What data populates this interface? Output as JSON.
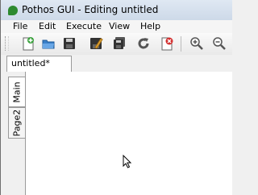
{
  "window": {
    "title": "Pothos GUI - Editing untitled",
    "app_icon": "pothos-leaf-icon"
  },
  "menu": {
    "items": [
      "File",
      "Edit",
      "Execute",
      "View",
      "Help"
    ]
  },
  "toolbar": {
    "buttons": [
      "new-document-icon",
      "open-folder-icon",
      "save-icon",
      "save-as-icon",
      "save-all-icon",
      "reload-icon",
      "close-document-icon",
      "zoom-in-icon",
      "zoom-out-icon"
    ]
  },
  "document_tabs": [
    {
      "label": "untitled*",
      "selected": true
    }
  ],
  "page_tabs": [
    {
      "label": "Main",
      "selected": true
    },
    {
      "label": "Page2",
      "selected": false
    }
  ],
  "colors": {
    "accent_green": "#2d8a2f",
    "accent_red": "#d32f2f",
    "toolbar_blue": "#2f6fb8"
  }
}
